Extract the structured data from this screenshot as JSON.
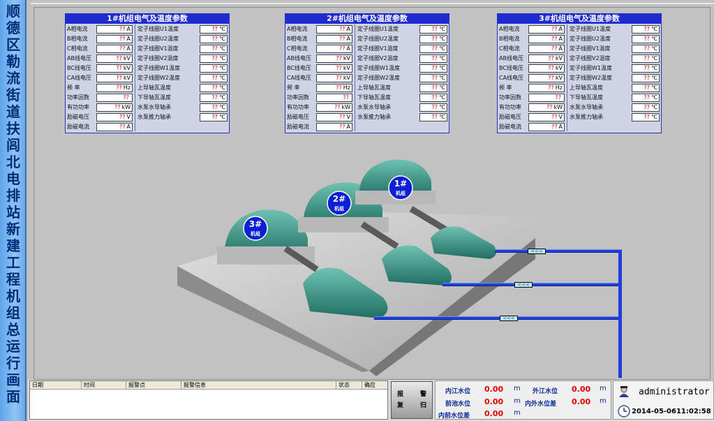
{
  "sidebar": {
    "title": "顺德区勒流街道扶闾北电排站新建工程机组总运行画面"
  },
  "panels": [
    {
      "title": "1#机组电气及温度参数"
    },
    {
      "title": "2#机组电气及温度参数"
    },
    {
      "title": "3#机组电气及温度参数"
    }
  ],
  "left_rows": [
    {
      "label": "A相电流",
      "value": "??",
      "unit": "A"
    },
    {
      "label": "B相电流",
      "value": "??",
      "unit": "A"
    },
    {
      "label": "C相电流",
      "value": "??",
      "unit": "A"
    },
    {
      "label": "AB线电压",
      "value": "??",
      "unit": "kV"
    },
    {
      "label": "BC线电压",
      "value": "??",
      "unit": "kV"
    },
    {
      "label": "CA线电压",
      "value": "??",
      "unit": "kV"
    },
    {
      "label": "频 率",
      "value": "??",
      "unit": "Hz"
    },
    {
      "label": "功率因数",
      "value": "??",
      "unit": ""
    },
    {
      "label": "有功功率",
      "value": "??",
      "unit": "kW"
    },
    {
      "label": "励磁电压",
      "value": "??",
      "unit": "V"
    },
    {
      "label": "励磁电流",
      "value": "??",
      "unit": "A"
    }
  ],
  "right_rows": [
    {
      "label": "定子线圈U1温度",
      "value": "??",
      "unit": "℃"
    },
    {
      "label": "定子线圈U2温度",
      "value": "??",
      "unit": "℃"
    },
    {
      "label": "定子线圈V1温度",
      "value": "??",
      "unit": "℃"
    },
    {
      "label": "定子线圈V2温度",
      "value": "??",
      "unit": "℃"
    },
    {
      "label": "定子线圈W1温度",
      "value": "??",
      "unit": "℃"
    },
    {
      "label": "定子线圈W2温度",
      "value": "??",
      "unit": "℃"
    },
    {
      "label": "上导轴瓦温度",
      "value": "??",
      "unit": "℃"
    },
    {
      "label": "下导轴瓦温度",
      "value": "??",
      "unit": "℃"
    },
    {
      "label": "水泵水导轴承",
      "value": "??",
      "unit": "℃"
    },
    {
      "label": "水泵推力轴承",
      "value": "??",
      "unit": "℃"
    }
  ],
  "units": [
    {
      "num": "1#",
      "name": "机组"
    },
    {
      "num": "2#",
      "name": "机组"
    },
    {
      "num": "3#",
      "name": "机组"
    }
  ],
  "valve_glyph": "<<<",
  "alarm": {
    "columns": [
      "日期",
      "时间",
      "报警点",
      "报警信息",
      "状态",
      "确应"
    ]
  },
  "ack_button": {
    "c1": "报",
    "c2": "警",
    "c3": "复",
    "c4": "归"
  },
  "water": {
    "inner_river_label": "内江水位",
    "inner_river_value": "0.00",
    "inner_river_unit": "m",
    "outer_river_label": "外江水位",
    "outer_river_value": "0.00",
    "outer_river_unit": "m",
    "forebay_label": "前池水位",
    "forebay_value": "0.00",
    "forebay_unit": "m",
    "inout_diff_label": "内外水位差",
    "inout_diff_value": "0.00",
    "inout_diff_unit": "m",
    "inner_forebay_diff_label": "内前水位差",
    "inner_forebay_diff_value": "0.00",
    "inner_forebay_diff_unit": "m"
  },
  "user": {
    "name": "administrator",
    "datetime": "2014-05-0611:02:58"
  },
  "colors": {
    "panel_title": "#1d2bd1",
    "pipe": "#1e3fd8",
    "machine": "#2d8c7c",
    "value_red": "#d40000"
  }
}
